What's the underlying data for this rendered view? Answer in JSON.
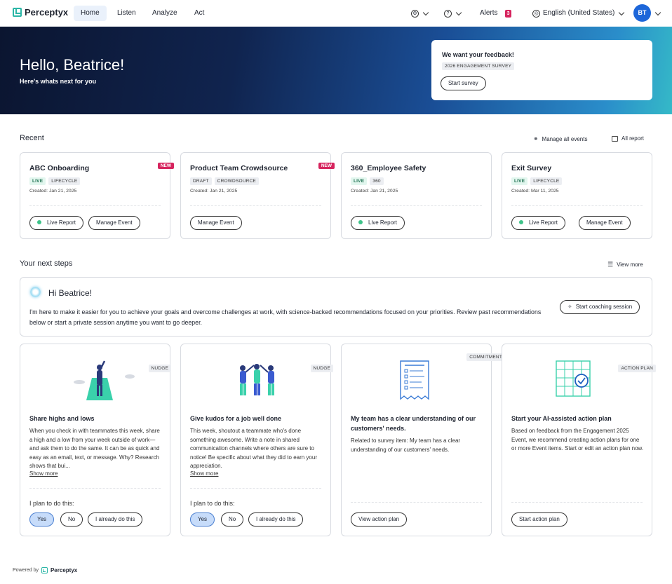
{
  "brand": {
    "name": "Perceptyx"
  },
  "nav": {
    "tabs": [
      "Home",
      "Listen",
      "Analyze",
      "Act"
    ],
    "alerts_label": "Alerts",
    "alerts_count": "3",
    "language": "English (United States)",
    "avatar_initials": "BT"
  },
  "hero": {
    "greeting": "Hello, Beatrice!",
    "subtitle": "Here's whats next for you",
    "feedback": {
      "title": "We want your feedback!",
      "tag": "2026 ENGAGEMENT SURVEY",
      "button": "Start survey"
    }
  },
  "recent": {
    "title": "Recent",
    "manage_all": "Manage all events",
    "all_report": "All report",
    "cards": [
      {
        "title": "ABC Onboarding",
        "new": "NEW",
        "tags": [
          "LIVE",
          "LIFECYCLE"
        ],
        "created": "Created: Jan 21, 2025",
        "buttons": [
          "Live Report",
          "Manage Event"
        ]
      },
      {
        "title": "Product Team Crowdsource",
        "new": "NEW",
        "tags": [
          "DRAFT",
          "CROWDSOURCE"
        ],
        "created": "Created: Jan 21, 2025",
        "buttons": [
          "Manage Event"
        ]
      },
      {
        "title": "360_Employee Safety",
        "new": "",
        "tags": [
          "LIVE",
          "360"
        ],
        "created": "Created: Jan 21, 2025",
        "buttons": [
          "Live Report"
        ]
      },
      {
        "title": "Exit Survey",
        "new": "",
        "tags": [
          "LIVE",
          "LIFECYCLE"
        ],
        "created": "Created: Mar 11, 2025",
        "buttons": [
          "Live Report",
          "Manage Event"
        ]
      }
    ]
  },
  "next_steps": {
    "title": "Your next steps",
    "view_more": "View more",
    "coach": {
      "greeting": "Hi Beatrice!",
      "text": "I'm here to make it easier for you to achieve your goals and overcome challenges at work, with science-backed recommendations focused on your priorities. Review past recommendations below or start a private session anytime you want to go deeper.",
      "button": "Start coaching session"
    },
    "cards": [
      {
        "badge": "NUDGE",
        "title": "Share highs and lows",
        "desc": "When you check in with teammates this week, share a high and a low from your week outside of work—and ask them to do the same. It can be as quick and easy as an email, text, or message. Why? Research shows that bui...",
        "show_more": "Show more",
        "plan_label": "I plan to do this:",
        "options": [
          "Yes",
          "No",
          "I already do this"
        ]
      },
      {
        "badge": "NUDGE",
        "title": "Give kudos for a job well done",
        "desc": "This week, shoutout a teammate who's done something awesome. Write a note in shared communication channels where others are sure to notice! Be specific about what they did to earn your appreciation.",
        "show_more": "Show more",
        "plan_label": "I plan to do this:",
        "options": [
          "Yes",
          "No",
          "I already do this"
        ]
      },
      {
        "badge": "COMMITMENT",
        "title": "My team has a clear understanding of our customers' needs.",
        "desc": "Related to survey item: My team has a clear understanding of our customers' needs.",
        "button": "View action plan"
      },
      {
        "badge": "ACTION PLAN",
        "title": "Start your AI-assisted action plan",
        "desc": "Based on feedback from the Engagement 2025 Event, we recommend creating action plans for one or more Event items. Start or edit an action plan now.",
        "button": "Start action plan"
      }
    ]
  },
  "footer": {
    "powered_by": "Powered by",
    "brand": "Perceptyx"
  }
}
